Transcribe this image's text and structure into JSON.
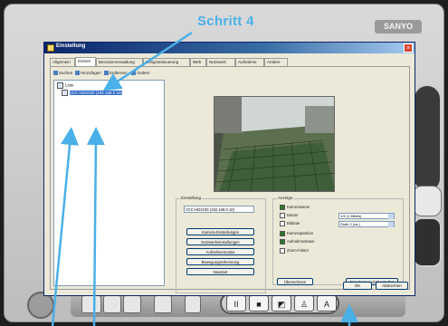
{
  "annotation": {
    "step_label": "Schritt 4"
  },
  "app": {
    "logo": "SANYO"
  },
  "dialog": {
    "title": "Einstellung",
    "close_glyph": "×",
    "tabs": [
      "Allgemein",
      "Einheit",
      "Benutzerverwaltung",
      "Ereignissteuerung",
      "Web",
      "Netzwerk",
      "Aufnahme",
      "Andere"
    ],
    "active_tab": 1,
    "toolbar": [
      "Suchen",
      "Hinzufügen",
      "Entfernen",
      "Ändern"
    ],
    "tree": [
      "Liste",
      "VCC-HD2100 (192.168.0.10)"
    ],
    "device_group": {
      "title": "Einstellung",
      "field_value": "VCC-HD2100 (192.168.0.10)",
      "buttons": [
        "Kamera-Einstellungen",
        "Netzwerkeinstellungen",
        "Aufnahmemodus",
        "Bewegungserkennung",
        "Neustart"
      ]
    },
    "settings_group": {
      "title": "Anzeige",
      "options": [
        {
          "label": "Kameraname",
          "checked": true
        },
        {
          "label": "Datum",
          "checked": false
        },
        {
          "label": "Bildrate",
          "checked": false
        },
        {
          "label": "Kameraposition",
          "checked": true
        },
        {
          "label": "Aufnahmestatus",
          "checked": true
        },
        {
          "label": "Zoom-Faktor",
          "checked": false
        }
      ],
      "combo1": "1/4 (1 Mbit/s)",
      "combo2": "Stufe 2 (ca.)",
      "btn_left": "Übernehmen",
      "btn_right": "Standard wiederherstellen"
    },
    "footer": {
      "ok": "OK",
      "cancel": "Abbrechen"
    }
  },
  "controls": [
    "II",
    "■",
    "◩",
    "♙",
    "A"
  ],
  "colors": {
    "annotation": "#4ab0e8",
    "title_bar": "#0a246a"
  }
}
